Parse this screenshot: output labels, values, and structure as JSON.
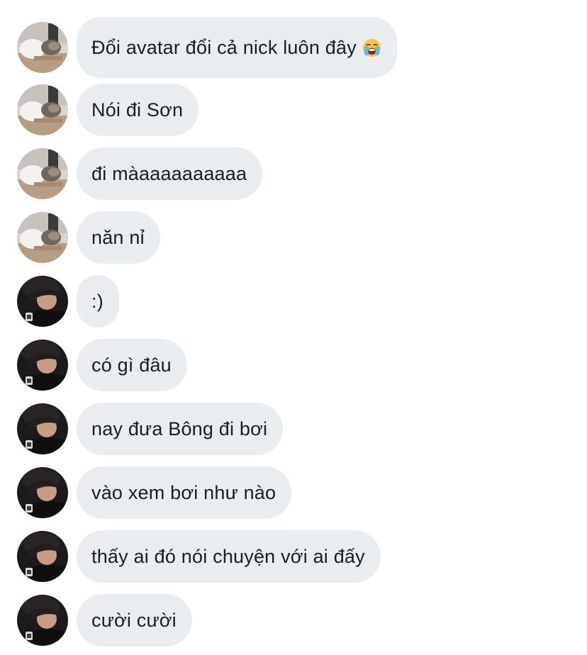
{
  "conversation": {
    "messages": [
      {
        "sender": "cat",
        "text": "Đổi avatar đổi cả nick luôn đây",
        "emoji": "loudly-crying-face"
      },
      {
        "sender": "cat",
        "text": "Nói đi Sơn"
      },
      {
        "sender": "cat",
        "text": "đi màaaaaaaaaaa"
      },
      {
        "sender": "cat",
        "text": "năn nỉ"
      },
      {
        "sender": "man",
        "text": ":)"
      },
      {
        "sender": "man",
        "text": "có gì đâu"
      },
      {
        "sender": "man",
        "text": "nay đưa Bông đi bơi"
      },
      {
        "sender": "man",
        "text": "vào xem bơi như nào"
      },
      {
        "sender": "man",
        "text": "thấy ai đó nói chuyện với ai đấy"
      },
      {
        "sender": "man",
        "text": "cười cười"
      }
    ]
  },
  "colors": {
    "bubble": "#e9edf0",
    "text": "#1c1e21",
    "background": "#ffffff"
  }
}
